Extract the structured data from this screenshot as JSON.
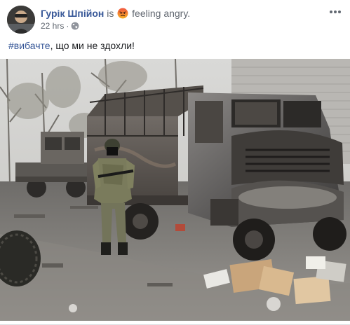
{
  "post": {
    "author": "Гурік Шпійон",
    "is_text": "is",
    "feeling": "feeling angry.",
    "timestamp": "22 hrs",
    "separator": "·",
    "message_hashtag": "#вибачте",
    "message_rest": ", що ми не здохли!",
    "icons": {
      "avatar": "profile-photo",
      "emoji": "angry-face",
      "privacy": "globe-icon",
      "menu": "more-options-icon"
    },
    "colors": {
      "link": "#385898",
      "secondary": "#606770",
      "emoji": "#f7b125"
    }
  }
}
